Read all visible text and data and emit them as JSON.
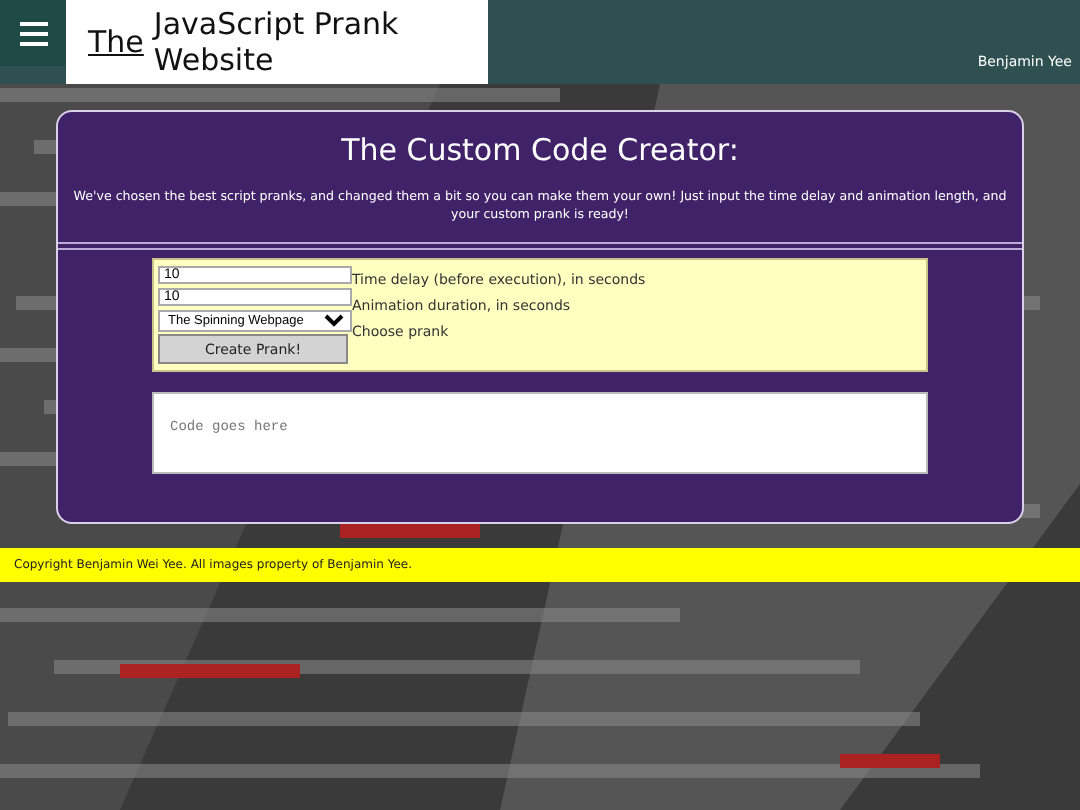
{
  "header": {
    "title_prefix": "The",
    "title": "JavaScript Prank Website",
    "author": "Benjamin Yee"
  },
  "creator": {
    "heading": "The Custom Code Creator:",
    "intro": "We've chosen the best script pranks, and changed them a bit so you can make them your own! Just input the time delay and animation length, and your custom prank is ready!",
    "fields": [
      {
        "kind": "input",
        "value": "10",
        "label": "Time delay (before execution), in seconds"
      },
      {
        "kind": "input",
        "value": "10",
        "label": "Animation duration, in seconds"
      },
      {
        "kind": "select",
        "value": "The Spinning Webpage",
        "label": "Choose prank"
      }
    ],
    "button": "Create Prank!",
    "code_output": {
      "placeholder": "Code goes here"
    }
  },
  "footer": {
    "text": "Copyright  Benjamin Wei Yee. All images property of  Benjamin Yee."
  }
}
